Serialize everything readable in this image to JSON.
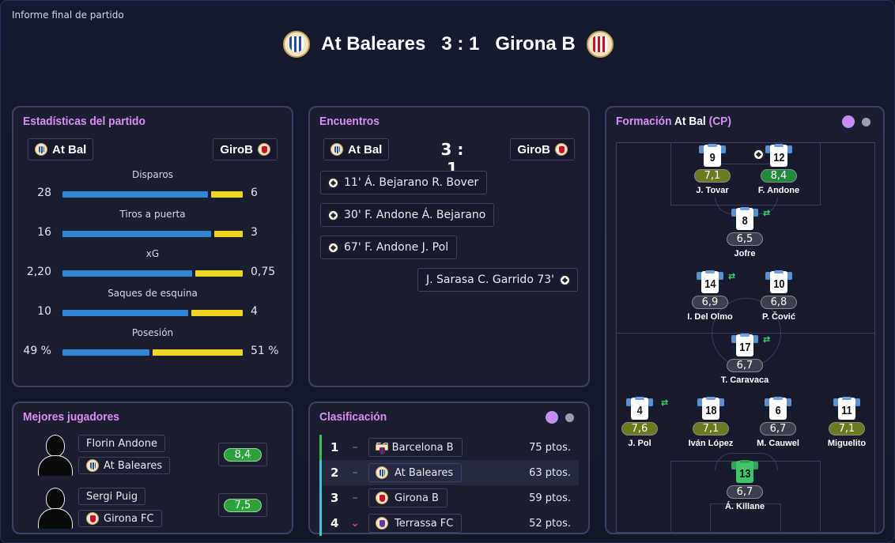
{
  "window": {
    "title": "Informe final de partido"
  },
  "match": {
    "home": "At Baleares",
    "away": "Girona B",
    "score": "3 : 1"
  },
  "stats": {
    "title": "Estadísticas del partido",
    "home": "At Bal",
    "away": "GiroB",
    "rows": [
      {
        "label": "Disparos",
        "home": "28",
        "away": "6",
        "home_share": 0.82,
        "away_share": 0.18
      },
      {
        "label": "Tiros a puerta",
        "home": "16",
        "away": "3",
        "home_share": 0.84,
        "away_share": 0.16
      },
      {
        "label": "xG",
        "home": "2,20",
        "away": "0,75",
        "home_share": 0.73,
        "away_share": 0.27
      },
      {
        "label": "Saques de esquina",
        "home": "10",
        "away": "4",
        "home_share": 0.71,
        "away_share": 0.29
      },
      {
        "label": "Posesión",
        "home": "49 %",
        "away": "51 %",
        "home_share": 0.49,
        "away_share": 0.51
      }
    ]
  },
  "encounters": {
    "title": "Encuentros",
    "home": "At Bal",
    "away": "GiroB",
    "score": "3 : 1",
    "events": [
      {
        "side": "home",
        "text": "11'  Á. Bejarano  R. Bover"
      },
      {
        "side": "home",
        "text": "30'  F. Andone  Á. Bejarano"
      },
      {
        "side": "home",
        "text": "67'  F. Andone  J. Pol"
      },
      {
        "side": "away",
        "text": "J. Sarasa  C. Garrido  73'"
      }
    ]
  },
  "formation": {
    "title_a": "Formación",
    "title_b": "At Bal",
    "title_c": "(CP)",
    "players": [
      {
        "num": "9",
        "name": "J. Tovar",
        "rating": "7,1",
        "tier": "olive"
      },
      {
        "num": "12",
        "name": "F. Andone",
        "rating": "8,4",
        "tier": "green"
      },
      {
        "num": "8",
        "name": "Jofre",
        "rating": "6,5",
        "tier": "grey"
      },
      {
        "num": "14",
        "name": "I. Del Olmo",
        "rating": "6,9",
        "tier": "grey"
      },
      {
        "num": "10",
        "name": "P. Čović",
        "rating": "6,8",
        "tier": "grey"
      },
      {
        "num": "17",
        "name": "T. Caravaca",
        "rating": "6,7",
        "tier": "grey"
      },
      {
        "num": "4",
        "name": "J. Pol",
        "rating": "7,6",
        "tier": "olive"
      },
      {
        "num": "18",
        "name": "Iván López",
        "rating": "7,1",
        "tier": "olive"
      },
      {
        "num": "6",
        "name": "M. Cauwel",
        "rating": "6,7",
        "tier": "grey"
      },
      {
        "num": "11",
        "name": "Miguelito",
        "rating": "7,1",
        "tier": "olive"
      },
      {
        "num": "13",
        "name": "Á. Killane",
        "rating": "6,7",
        "tier": "grey"
      }
    ]
  },
  "best": {
    "title": "Mejores jugadores",
    "players": [
      {
        "name": "Florin Andone",
        "club": "At Baleares",
        "rating": "8,4"
      },
      {
        "name": "Sergi Puig",
        "club": "Girona FC",
        "rating": "7,5"
      }
    ]
  },
  "table": {
    "title": "Clasificación",
    "rows": [
      {
        "pos": "1",
        "team": "FC Barcelona B",
        "pts": "75 ptos.",
        "move": "–"
      },
      {
        "pos": "2",
        "team": "At Baleares",
        "pts": "63 ptos.",
        "move": "–"
      },
      {
        "pos": "3",
        "team": "Girona B",
        "pts": "59 ptos.",
        "move": "–"
      },
      {
        "pos": "4",
        "team": "Terrassa FC",
        "pts": "52 ptos.",
        "move": "⌄"
      }
    ]
  },
  "colors": {
    "accent": "#d98ef5",
    "home_bar": "#2f86d6",
    "away_bar": "#f2d522"
  }
}
